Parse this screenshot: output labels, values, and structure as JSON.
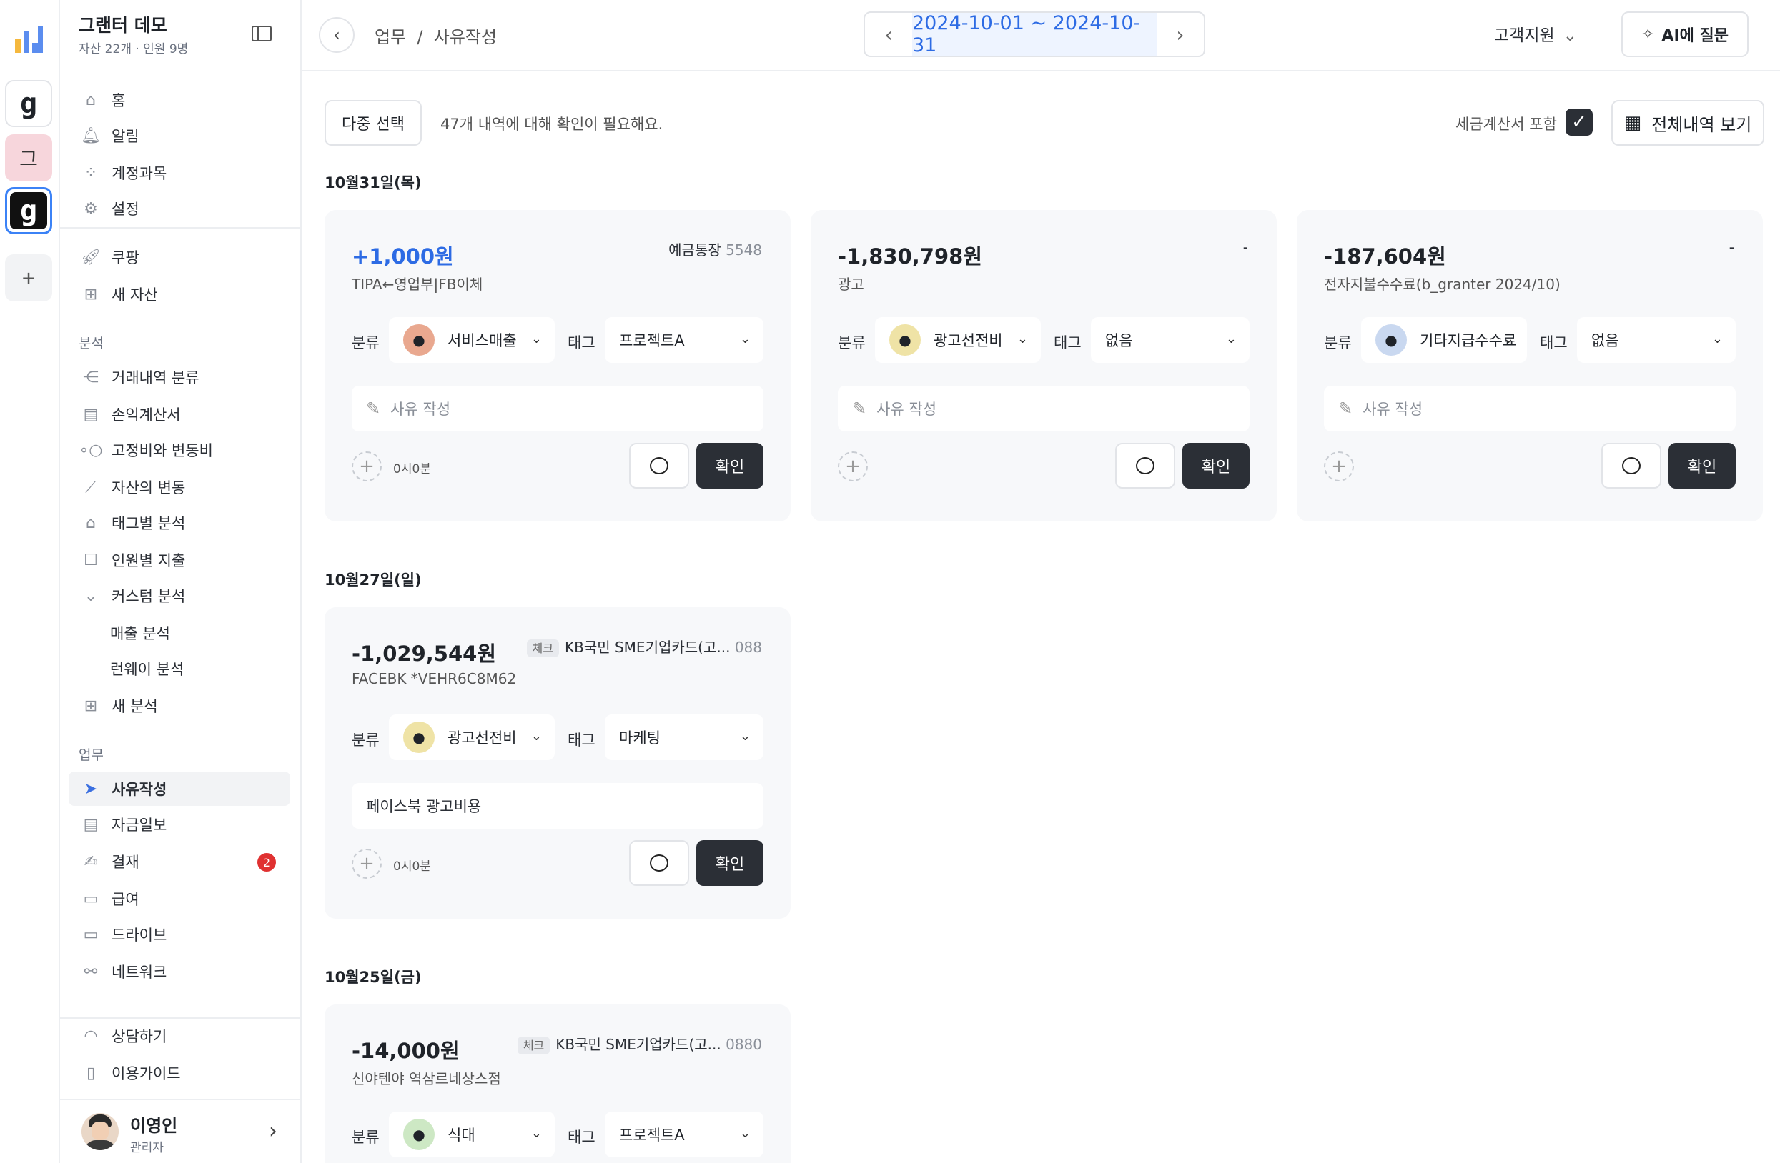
{
  "rail": {
    "add": "+"
  },
  "sidebar": {
    "org_name": "그랜터 데모",
    "org_sub": "자산 22개 · 인원 9명",
    "main_items": [
      "홈",
      "알림",
      "계정과목",
      "설정"
    ],
    "extra_items": [
      "쿠팡",
      "새 자산"
    ],
    "analysis_title": "분석",
    "analysis_items": [
      "거래내역 분류",
      "손익계산서",
      "고정비와 변동비",
      "자산의 변동",
      "태그별 분석",
      "인원별 지출",
      "커스텀 분석"
    ],
    "custom_sub": [
      "매출 분석",
      "런웨이 분석"
    ],
    "new_analysis": "새 분석",
    "work_title": "업무",
    "work_items": [
      "사유작성",
      "자금일보",
      "결재",
      "급여",
      "드라이브",
      "네트워크"
    ],
    "approval_badge": "2",
    "footer_items": [
      "상담하기",
      "이용가이드"
    ],
    "user_name": "이영인",
    "user_role": "관리자"
  },
  "header": {
    "crumb": "업무  /  사유작성",
    "date_range": "2024-10-01 ~ 2024-10-31",
    "support": "고객지원",
    "ai_button": "AI에 질문"
  },
  "toolbar": {
    "multi_select": "다중 선택",
    "notice": "47개 내역에 대해 확인이 필요해요.",
    "tax_label": "세금계산서 포함",
    "view_all": "전체내역 보기"
  },
  "labels": {
    "category": "분류",
    "tag": "태그",
    "memo_placeholder": "사유 작성",
    "confirm": "확인"
  },
  "groups": [
    {
      "date": "10월31일(목)",
      "cards": [
        {
          "amount": "+1,000원",
          "positive": true,
          "desc": "TIPA←영업부|FB이체",
          "account": "예금통장",
          "acct_num": "5548",
          "chip": "",
          "category": "서비스매출",
          "tag": "프로젝트A",
          "memo": "",
          "time": "0시0분",
          "icon_color": "#e9a88f"
        },
        {
          "amount": "-1,830,798원",
          "positive": false,
          "desc": "광고",
          "account": "-",
          "acct_num": "",
          "chip": "",
          "category": "광고선전비",
          "tag": "없음",
          "memo": "",
          "time": "",
          "icon_color": "#efe3a6"
        },
        {
          "amount": "-187,604원",
          "positive": false,
          "desc": "전자지불수수료(b_granter 2024/10)",
          "account": "-",
          "acct_num": "",
          "chip": "",
          "category": "기타지급수수료",
          "tag": "없음",
          "memo": "",
          "time": "",
          "icon_color": "#c9d8f0"
        }
      ]
    },
    {
      "date": "10월27일(일)",
      "cards": [
        {
          "amount": "-1,029,544원",
          "positive": false,
          "desc": "FACEBK *VEHR6C8M62",
          "account": "KB국민 SME기업카드(고...",
          "acct_num": "088",
          "chip": "체크",
          "category": "광고선전비",
          "tag": "마케팅",
          "memo": "페이스북 광고비용",
          "time": "0시0분",
          "icon_color": "#efe3a6"
        }
      ]
    },
    {
      "date": "10월25일(금)",
      "cards": [
        {
          "amount": "-14,000원",
          "positive": false,
          "desc": "신야텐야 역삼르네상스점",
          "account": "KB국민 SME기업카드(고...",
          "acct_num": "0880",
          "chip": "체크",
          "category": "식대",
          "tag": "프로젝트A",
          "memo": "",
          "time": "",
          "icon_color": "#cde8c4"
        }
      ]
    }
  ]
}
